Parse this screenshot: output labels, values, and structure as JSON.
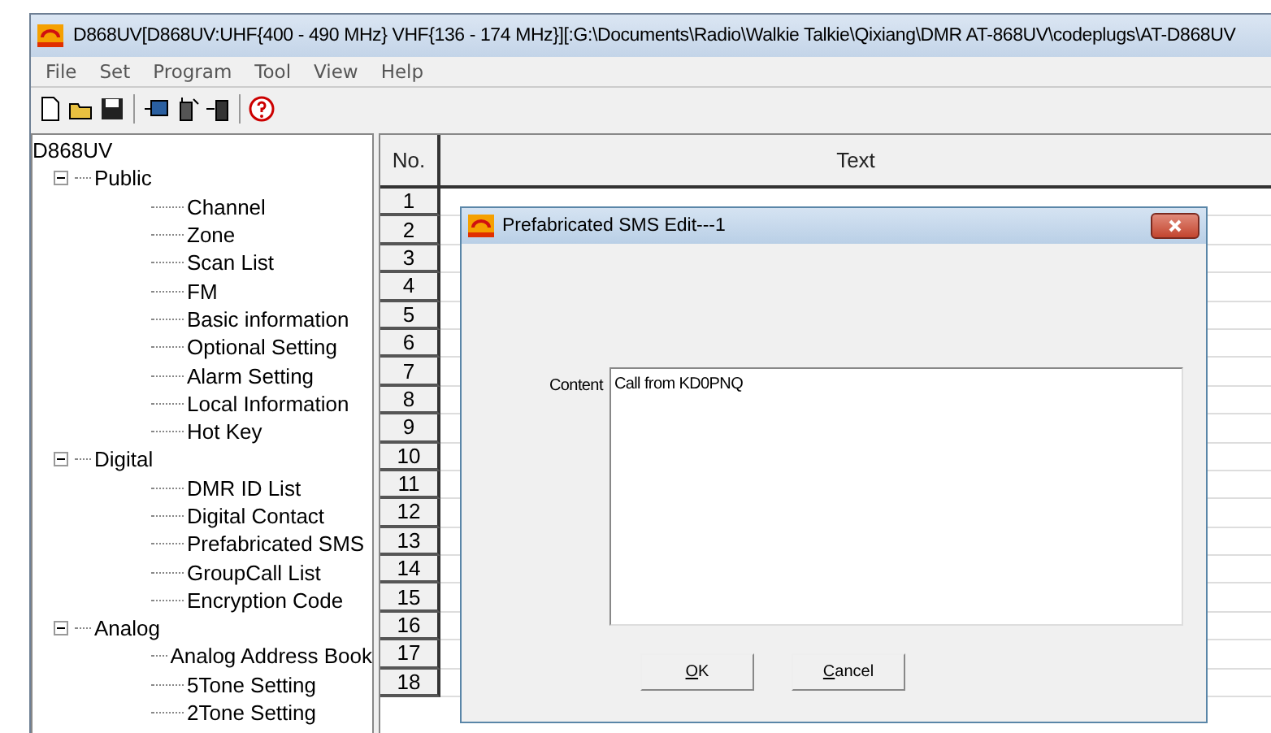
{
  "window": {
    "title": "D868UV[D868UV:UHF{400 - 490 MHz} VHF{136 - 174 MHz}][:G:\\Documents\\Radio\\Walkie Talkie\\Qixiang\\DMR AT-868UV\\codeplugs\\AT-D868UV"
  },
  "menu": [
    "File",
    "Set",
    "Program",
    "Tool",
    "View",
    "Help"
  ],
  "toolbar": [
    {
      "kind": "new"
    },
    {
      "kind": "open"
    },
    {
      "kind": "save"
    },
    {
      "kind": "sep"
    },
    {
      "kind": "read"
    },
    {
      "kind": "radio"
    },
    {
      "kind": "write"
    },
    {
      "kind": "sep"
    },
    {
      "kind": "help"
    }
  ],
  "tree": {
    "label": "D868UV",
    "children": [
      {
        "label": "Public",
        "expanded": true,
        "children": [
          {
            "label": "Channel"
          },
          {
            "label": "Zone"
          },
          {
            "label": "Scan List"
          },
          {
            "label": "FM"
          },
          {
            "label": "Basic information"
          },
          {
            "label": "Optional Setting"
          },
          {
            "label": "Alarm Setting"
          },
          {
            "label": "Local Information"
          },
          {
            "label": "Hot Key"
          }
        ]
      },
      {
        "label": "Digital",
        "expanded": true,
        "children": [
          {
            "label": "DMR ID List"
          },
          {
            "label": "Digital Contact"
          },
          {
            "label": "Prefabricated SMS"
          },
          {
            "label": "GroupCall List"
          },
          {
            "label": "Encryption Code"
          }
        ]
      },
      {
        "label": "Analog",
        "expanded": true,
        "children": [
          {
            "label": "Analog Address Book"
          },
          {
            "label": "5Tone Setting"
          },
          {
            "label": "2Tone Setting"
          }
        ]
      }
    ]
  },
  "table": {
    "columns": [
      "No.",
      "Text"
    ],
    "rows": [
      "1",
      "2",
      "3",
      "4",
      "5",
      "6",
      "7",
      "8",
      "9",
      "10",
      "11",
      "12",
      "13",
      "14",
      "15",
      "16",
      "17",
      "18"
    ]
  },
  "dialog": {
    "title": "Prefabricated SMS Edit---1",
    "content_label": "Content",
    "content_value": "Call from KD0PNQ",
    "buttons": [
      {
        "label": "OK"
      },
      {
        "label": "Cancel"
      }
    ]
  }
}
